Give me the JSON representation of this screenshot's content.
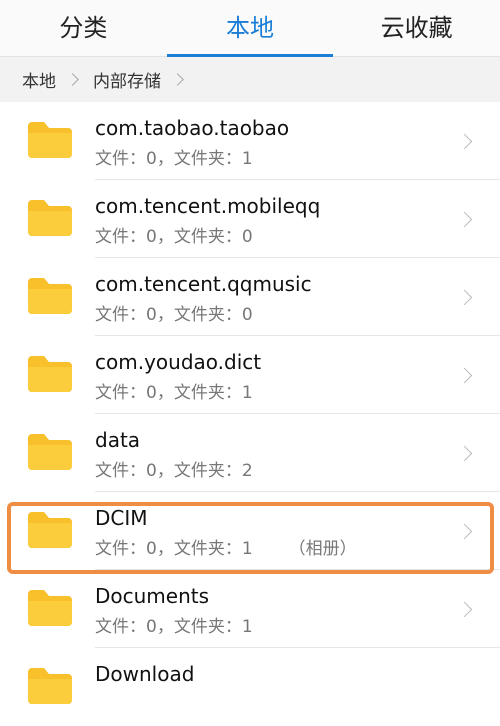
{
  "tabs": [
    {
      "label": "分类"
    },
    {
      "label": "本地"
    },
    {
      "label": "云收藏"
    }
  ],
  "breadcrumb": [
    {
      "label": "本地"
    },
    {
      "label": "内部存储"
    }
  ],
  "files": [
    {
      "name": "com.taobao.taobao",
      "meta": "文件：0，文件夹：1",
      "tag": ""
    },
    {
      "name": "com.tencent.mobileqq",
      "meta": "文件：0，文件夹：0",
      "tag": ""
    },
    {
      "name": "com.tencent.qqmusic",
      "meta": "文件：0，文件夹：0",
      "tag": ""
    },
    {
      "name": "com.youdao.dict",
      "meta": "文件：0，文件夹：1",
      "tag": ""
    },
    {
      "name": "data",
      "meta": "文件：0，文件夹：2",
      "tag": ""
    },
    {
      "name": "DCIM",
      "meta": "文件：0，文件夹：1",
      "tag": "（相册）"
    },
    {
      "name": "Documents",
      "meta": "文件：0，文件夹：1",
      "tag": ""
    },
    {
      "name": "Download",
      "meta": "",
      "tag": ""
    }
  ],
  "colors": {
    "accent": "#1a7dd6",
    "folder": "#f8c02a",
    "highlight": "#ee8d43"
  }
}
